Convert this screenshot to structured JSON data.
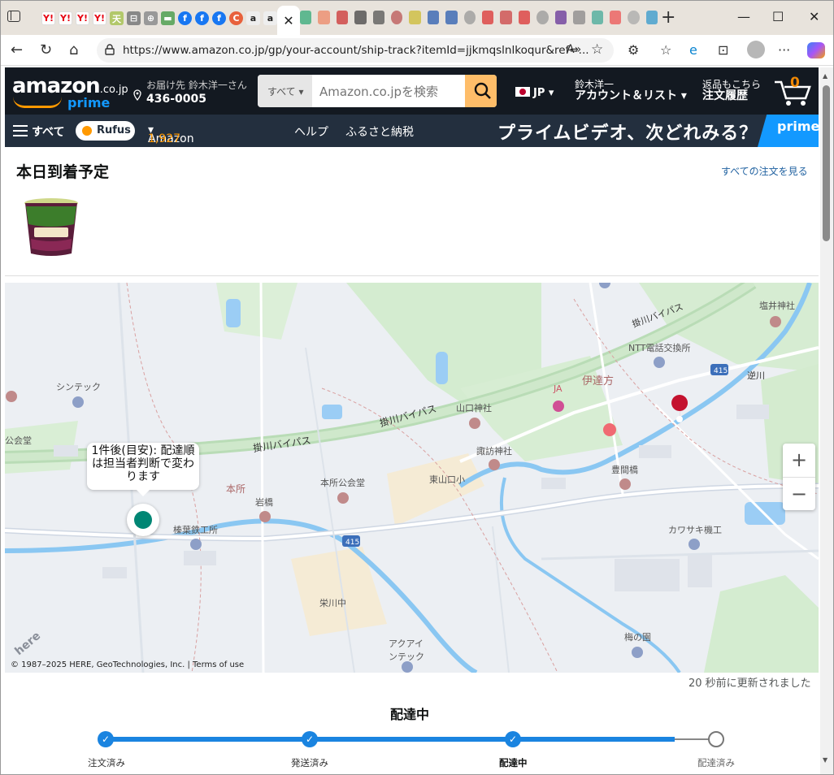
{
  "browser": {
    "url": "https://www.amazon.co.jp/gp/your-account/ship-track?itemId=jjkmqslnlkoqur&ref=...",
    "reader_label": "A̅",
    "fav_tabs": [
      "Y!",
      "Y!",
      "Y!",
      "Y!",
      "天",
      "⊟",
      "⊕",
      "▬",
      "f",
      "f",
      "f",
      "C",
      "a",
      "a"
    ]
  },
  "header": {
    "logo_main": "amazon",
    "logo_suffix": ".co.jp",
    "logo_prime": "prime",
    "deliver_to_label": "お届け先 鈴木洋一さん",
    "postal_code": "436-0005",
    "search_category": "すべて",
    "search_placeholder": "Amazon.co.jpを検索",
    "language": "JP",
    "account_top": "鈴木洋一",
    "account_main": "アカウント＆リスト",
    "orders_top": "返品もこちら",
    "orders_main": "注文履歴",
    "cart_count": "0"
  },
  "subnav": {
    "all": "すべて",
    "rufus": "Rufus",
    "points_label": "Amazonポイント:",
    "points_value": "1,927",
    "help": "ヘルプ",
    "furusato": "ふるさと納税",
    "banner": "プライムビデオ、次どれみる？",
    "banner_badge": "prime"
  },
  "main": {
    "title": "本日到着予定",
    "all_orders_link": "すべての注文を見る"
  },
  "map": {
    "bubble_text": "1件後(目安): 配達順は担当者判断で変わります",
    "zoom_in": "+",
    "zoom_out": "−",
    "copyright": "© 1987–2025 HERE, GeoTechnologies, Inc.  |  Terms of use",
    "watermark": "here",
    "labels": [
      "塩井神社",
      "掛川バイパス",
      "NTT電話交換所",
      "伊達方",
      "逆川",
      "415",
      "シンテック",
      "JA",
      "山口神社",
      "掛川バイパス",
      "掛川バイパス",
      "諏訪神社",
      "東山口小",
      "豊間橋",
      "公会堂",
      "本所",
      "岩橋",
      "本所公会堂",
      "榛葉鉄工所",
      "415",
      "カワサキ機工",
      "栄川中",
      "梅の園",
      "アクアインテック"
    ]
  },
  "updated": "20 秒前に更新されました",
  "progress": {
    "status": "配達中",
    "steps": [
      "注文済み",
      "発送済み",
      "配達中",
      "配達済み"
    ],
    "current_step": 3
  },
  "colors": {
    "amazon_dark": "#131921",
    "subnav": "#232f3e",
    "accent_orange": "#febd69",
    "prime_blue": "#1399ff",
    "progress_blue": "#1a84e0",
    "map_dot": "#008674"
  }
}
